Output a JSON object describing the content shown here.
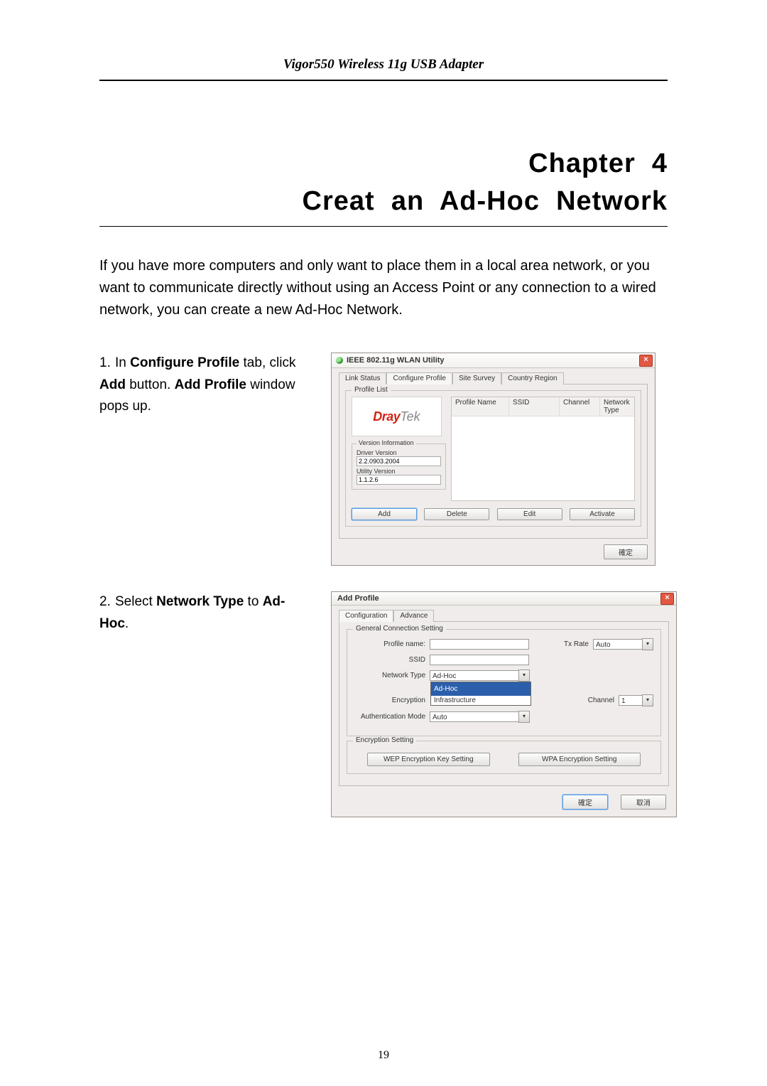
{
  "running_head": "Vigor550 Wireless 11g USB Adapter",
  "chapter": {
    "number": "Chapter  4",
    "title": "Creat  an  Ad-Hoc  Network"
  },
  "intro": "If you have more computers and only want to place them in a local area network, or you want to communicate directly without using an Access Point or any connection to a wired network, you can create a new Ad-Hoc Network.",
  "steps": [
    {
      "num": "1.",
      "parts": [
        {
          "t": "In ",
          "b": false
        },
        {
          "t": "Configure Profile",
          "b": true
        },
        {
          "t": " tab, click ",
          "b": false
        },
        {
          "t": "Add",
          "b": true
        },
        {
          "t": " button. ",
          "b": false
        },
        {
          "t": "Add Profile",
          "b": true
        },
        {
          "t": " window pops up.",
          "b": false
        }
      ]
    },
    {
      "num": "2.",
      "parts": [
        {
          "t": "Select ",
          "b": false
        },
        {
          "t": "Network Type",
          "b": true
        },
        {
          "t": " to ",
          "b": false
        },
        {
          "t": "Ad-Hoc",
          "b": true
        },
        {
          "t": ".",
          "b": false
        }
      ]
    }
  ],
  "dialog1": {
    "title": "IEEE 802.11g WLAN Utility",
    "tabs": [
      "Link Status",
      "Configure Profile",
      "Site Survey",
      "Country Region"
    ],
    "active_tab": 1,
    "profile_list_label": "Profile List",
    "logo": {
      "dray": "Dray",
      "tek": "Tek"
    },
    "version_block": {
      "title": "Version Information",
      "driver_label": "Driver Version",
      "driver_value": "2.2.0903.2004",
      "utility_label": "Utility Version",
      "utility_value": "1.1.2.6"
    },
    "list_headers": [
      "Profile Name",
      "SSID",
      "Channel",
      "Network Type"
    ],
    "buttons": [
      "Add",
      "Delete",
      "Edit",
      "Activate"
    ],
    "ok": "確定"
  },
  "dialog2": {
    "title": "Add Profile",
    "tabs": [
      "Configuration",
      "Advance"
    ],
    "active_tab": 0,
    "group1_title": "General Connection Setting",
    "fields": {
      "profile_name": "Profile name:",
      "txrate_label": "Tx Rate",
      "txrate_value": "Auto",
      "ssid": "SSID",
      "network_type": "Network Type",
      "network_type_value": "Ad-Hoc",
      "network_type_options": [
        "Ad-Hoc",
        "Infrastructure"
      ],
      "encryption": "Encryption",
      "channel_label": "Channel",
      "channel_value": "1",
      "auth_mode": "Authentication Mode",
      "auth_value": "Auto"
    },
    "group2_title": "Encryption Setting",
    "enc_buttons": [
      "WEP Encryption Key Setting",
      "WPA Encryption Setting"
    ],
    "ok": "確定",
    "cancel": "取消"
  },
  "page_number": "19"
}
